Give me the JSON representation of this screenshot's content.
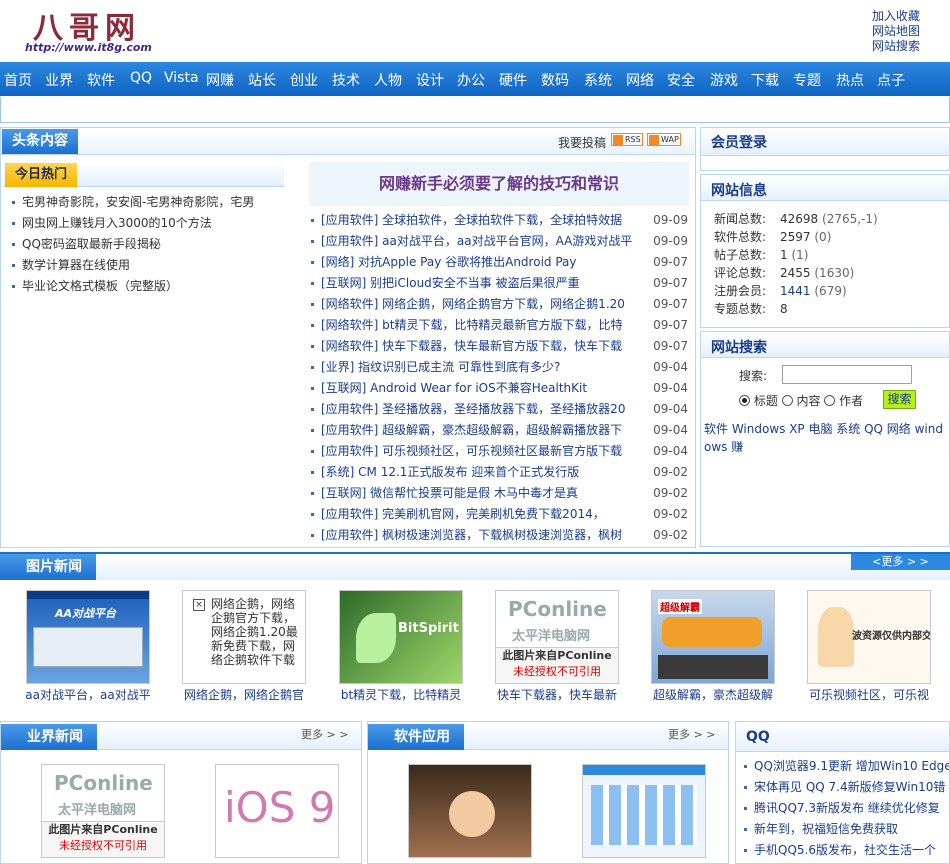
{
  "logo": {
    "text": "八哥网",
    "url": "http://www.it8g.com"
  },
  "top_links": [
    "加入收藏",
    "网站地图",
    "网站搜索"
  ],
  "nav": [
    "首页",
    "业界",
    "软件",
    "QQ",
    "Vista",
    "网赚",
    "站长",
    "创业",
    "技术",
    "人物",
    "设计",
    "办公",
    "硬件",
    "数码",
    "系统",
    "网络",
    "安全",
    "游戏",
    "下载",
    "专题",
    "热点",
    "点子"
  ],
  "headlines": {
    "title": "头条内容",
    "submit": "我要投稿",
    "rss": "RSS",
    "wap": "WAP",
    "today_hot_title": "今日热门",
    "today_hot": [
      "宅男神奇影院，安安阁-宅男神奇影院，宅男",
      "网虫网上赚钱月入3000的10个方法",
      "QQ密码盗取最新手段揭秘",
      "数学计算器在线使用",
      "毕业论文格式模板（完整版）"
    ],
    "feature_title": "网赚新手必须要了解的技巧和常识",
    "items": [
      {
        "text": "[应用软件] 全球拍软件，全球拍软件下载，全球拍特效据",
        "date": "09-09"
      },
      {
        "text": "[应用软件] aa对战平台，aa对战平台官网，AA游戏对战平",
        "date": "09-09"
      },
      {
        "text": "[网络] 对抗Apple Pay 谷歌将推出Android Pay",
        "date": "09-07"
      },
      {
        "text": "[互联网] 别把iCloud安全不当事 被盗后果很严重",
        "date": "09-07"
      },
      {
        "text": "[网络软件] 网络企鹅，网络企鹅官方下载，网络企鹅1.20",
        "date": "09-07"
      },
      {
        "text": "[网络软件] bt精灵下载，比特精灵最新官方版下载，比特",
        "date": "09-07"
      },
      {
        "text": "[网络软件] 快车下载器，快车最新官方版下载，快车下载",
        "date": "09-07"
      },
      {
        "text": "[业界] 指纹识别已成主流 可靠性到底有多少?",
        "date": "09-04"
      },
      {
        "text": "[互联网] Android Wear for iOS不兼容HealthKit",
        "date": "09-04"
      },
      {
        "text": "[应用软件] 圣经播放器，圣经播放器下载，圣经播放器20",
        "date": "09-04"
      },
      {
        "text": "[应用软件] 超级解霸，豪杰超级解霸，超级解霸播放器下",
        "date": "09-04"
      },
      {
        "text": "[应用软件] 可乐视频社区，可乐视频社区最新官方版下载",
        "date": "09-04"
      },
      {
        "text": "[系统] CM 12.1正式版发布 迎来首个正式发行版",
        "date": "09-02"
      },
      {
        "text": "[互联网] 微信帮忙投票可能是假 木马中毒才是真",
        "date": "09-02"
      },
      {
        "text": "[应用软件] 完美刷机官网，完美刷机免费下载2014，",
        "date": "09-02"
      },
      {
        "text": "[应用软件] 枫树极速浏览器，下载枫树极速浏览器，枫树",
        "date": "09-02"
      }
    ]
  },
  "member_login": {
    "title": "会员登录"
  },
  "site_info": {
    "title": "网站信息",
    "rows": [
      {
        "label": "新闻总数:",
        "value": "42698",
        "extra": "(2765,-1)"
      },
      {
        "label": "软件总数:",
        "value": "2597",
        "extra": "(0)"
      },
      {
        "label": "帖子总数:",
        "value": "1",
        "extra": "(1)"
      },
      {
        "label": "评论总数:",
        "value": "2455",
        "extra": "(1630)"
      },
      {
        "label": "注册会员:",
        "value": "1441",
        "extra": "(679)"
      },
      {
        "label": "专题总数:",
        "value": "8",
        "extra": ""
      }
    ]
  },
  "site_search": {
    "title": "网站搜索",
    "label": "搜索:",
    "options": [
      "标题",
      "内容",
      "作者"
    ],
    "button": "搜索",
    "tags": "软件 Windows XP 电脑 系统 QQ 网络 windows 赚"
  },
  "photo_news": {
    "title": "图片新闻",
    "more": "<更多 > >",
    "items": [
      {
        "caption": "aa对战平台，aa对战平",
        "thumb": "AA对战平台"
      },
      {
        "caption": "网络企鹅，网络企鹅官",
        "thumb": "网络企鹅，网络企鹅官方下载，网络企鹅1.20最新免费下载，网络企鹅软件下载"
      },
      {
        "caption": "bt精灵下载，比特精灵",
        "thumb": "BitSpirit"
      },
      {
        "caption": "快车下载器，快车最新",
        "thumb": "PConline"
      },
      {
        "caption": "超级解霸，豪杰超级解",
        "thumb": "超级解霸"
      },
      {
        "caption": "可乐视频社区，可乐视",
        "thumb": "波资源仅供内部交流"
      }
    ]
  },
  "pconline": {
    "brand": "PConline",
    "sub": "太平洋电脑网",
    "note1": "此图片来自PConline",
    "note2": "未经授权不可引用"
  },
  "industry_news": {
    "title": "业界新闻",
    "more": "更多 > >",
    "thumbs": [
      "PConline",
      "iOS 9"
    ]
  },
  "software_apps": {
    "title": "软件应用",
    "more": "更多 > >"
  },
  "qq": {
    "title": "QQ",
    "items": [
      "QQ浏览器9.1更新 增加Win10 Edge",
      "宋体再见 QQ 7.4新版修复Win10错",
      "腾讯QQ7.3新版发布 继续优化修复",
      "新年到，祝福短信免费获取",
      "手机QQ5.6版发布，社交生活一个"
    ]
  },
  "colors": {
    "nav": "#1d6fcf",
    "accent": "#1a3d8a",
    "border": "#bcd6f0"
  }
}
